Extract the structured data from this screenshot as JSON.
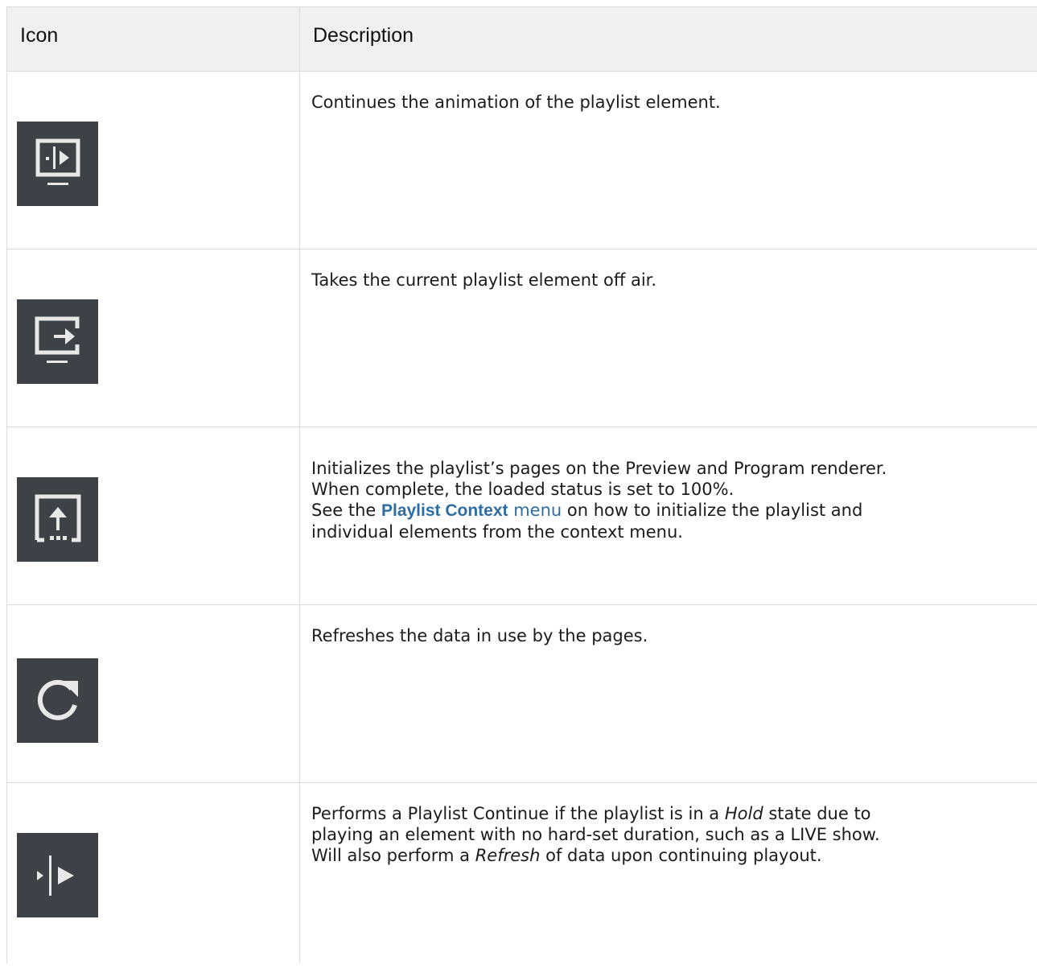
{
  "header": {
    "icon_col": "Icon",
    "desc_col": "Description"
  },
  "rows": [
    {
      "icon": "continue-monitor-icon",
      "description": "Continues the animation of the playlist element."
    },
    {
      "icon": "take-out-monitor-icon",
      "description": "Takes the current playlist element off air."
    },
    {
      "icon": "initialize-upload-icon",
      "line1": "Initializes the playlist’s pages on the Preview and Program renderer.",
      "line2": "When complete, the loaded status is set to 100%.",
      "line3_pre": "See the ",
      "link_bold": "Playlist Context",
      "link_plain": " menu",
      "line3_post": " on how to initialize the playlist and",
      "line4": "individual elements from the context menu."
    },
    {
      "icon": "refresh-icon",
      "description": "Refreshes the data in use by the pages."
    },
    {
      "icon": "playlist-continue-icon",
      "part1": "Performs a Playlist Continue if the playlist is in a ",
      "hold": "Hold",
      "part2": " state due to",
      "line2": "playing an element with no hard-set duration, such as a LIVE show.",
      "part3": "Will also perform a ",
      "refresh": "Refresh",
      "part4": " of data upon continuing playout."
    }
  ]
}
